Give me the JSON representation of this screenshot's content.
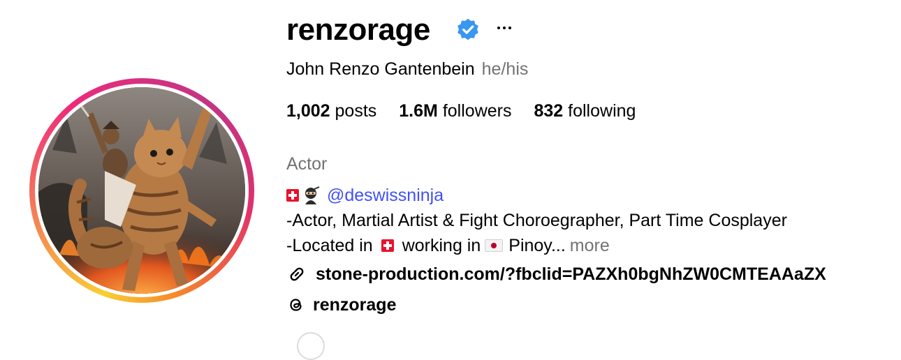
{
  "profile": {
    "username": "renzorage",
    "full_name": "John Renzo Gantenbein",
    "pronouns": "he/his",
    "category": "Actor"
  },
  "stats": {
    "posts_count": "1,002",
    "posts_label": "posts",
    "followers_count": "1.6M",
    "followers_label": "followers",
    "following_count": "832",
    "following_label": "following"
  },
  "bio": {
    "mention": "@deswissninja",
    "line2": "-Actor, Martial Artist & Fight Choroegrapher, Part Time Cosplayer",
    "line3_prefix": "-Located in",
    "line3_middle": "working in",
    "line3_suffix": "Pinoy...",
    "more_label": "more"
  },
  "link": {
    "url": "stone-production.com/?fbclid=PAZXh0bgNhZW0CMTEAAaZX"
  },
  "threads": {
    "handle": "renzorage"
  },
  "colors": {
    "accent_link": "#4150f7",
    "verified": "#3897f0",
    "muted": "#737373"
  },
  "icons": {
    "verified": "verified-badge-icon",
    "more": "more-options-icon",
    "link": "link-icon",
    "threads": "threads-icon",
    "flag_switzerland": "flag-switzerland-icon",
    "flag_japan": "flag-japan-icon",
    "ninja": "ninja-icon"
  }
}
